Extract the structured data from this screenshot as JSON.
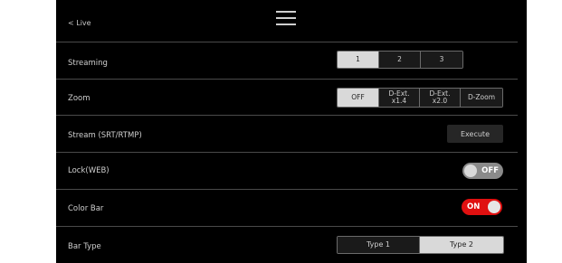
{
  "header": {
    "back_label": "< Live",
    "menu_icon": "hamburger-menu-icon"
  },
  "settings": {
    "streaming": {
      "label": "Streaming",
      "options": [
        "1",
        "2",
        "3"
      ],
      "selected": "1"
    },
    "zoom": {
      "label": "Zoom",
      "options": [
        "OFF",
        "D-Ext.\nx1.4",
        "D-Ext.\nx2.0",
        "D-Zoom"
      ],
      "selected": "OFF"
    },
    "stream_srt": {
      "label": "Stream (SRT/RTMP)",
      "button_label": "Execute"
    },
    "lock_web": {
      "label": "Lock(WEB)",
      "state": "OFF"
    },
    "color_bar": {
      "label": "Color Bar",
      "state": "ON"
    },
    "bar_type": {
      "label": "Bar Type",
      "options": [
        "Type 1",
        "Type 2"
      ],
      "selected": "Type 2"
    }
  },
  "colors": {
    "background": "#000000",
    "toggle_on": "#e01010",
    "toggle_off": "#8a8a8a",
    "segment_active": "#d9d9d9"
  }
}
